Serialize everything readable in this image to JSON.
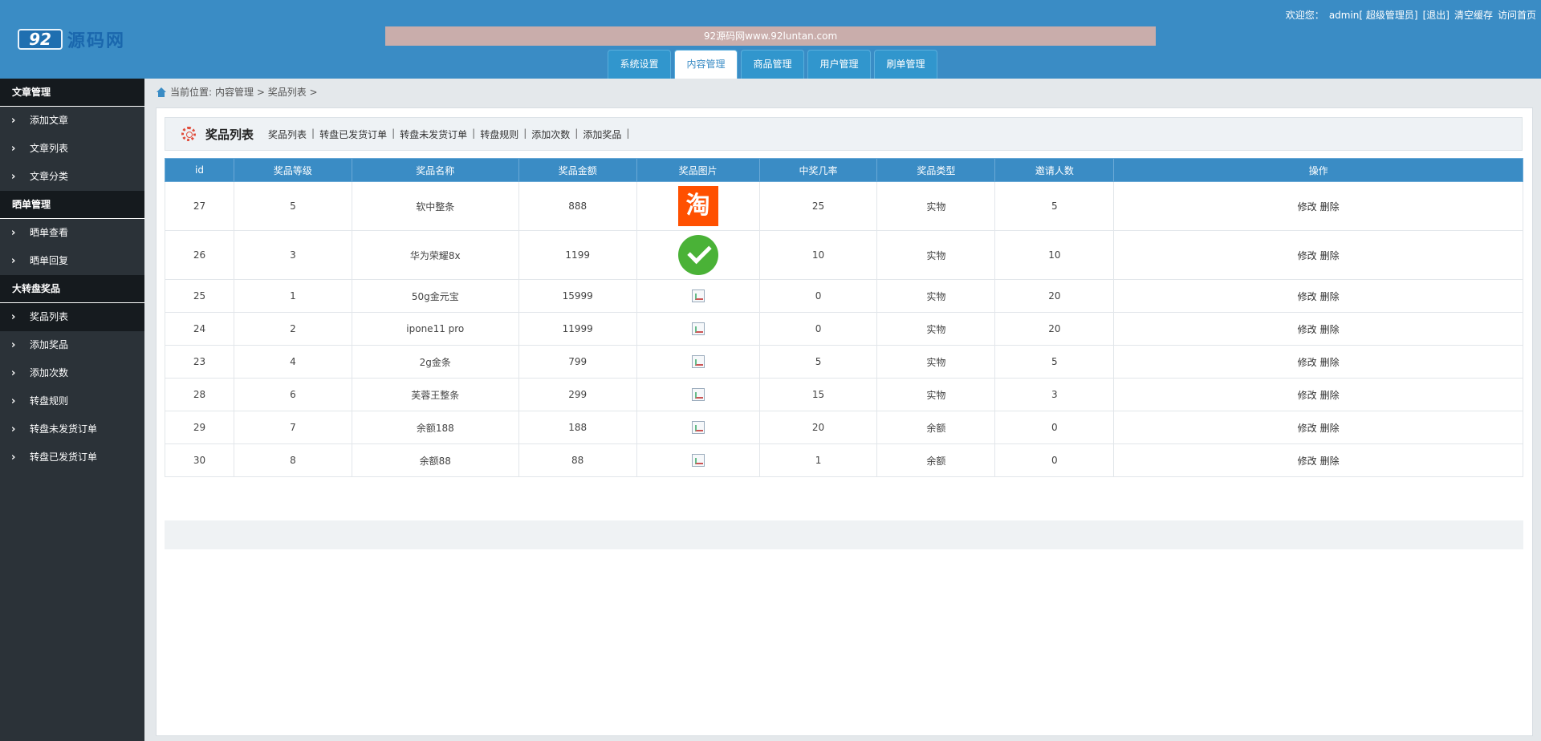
{
  "header": {
    "logo_badge": "92",
    "logo_text": "源码网",
    "banner": "92源码网www.92luntan.com",
    "tabs": [
      {
        "label": "系统设置",
        "active": false
      },
      {
        "label": "内容管理",
        "active": true
      },
      {
        "label": "商品管理",
        "active": false
      },
      {
        "label": "用户管理",
        "active": false
      },
      {
        "label": "刷单管理",
        "active": false
      }
    ],
    "user": {
      "welcome": "欢迎您：",
      "name": "admin[ 超级管理员]",
      "logout": "[退出]",
      "clear_cache": "清空缓存",
      "visit_home": "访问首页"
    }
  },
  "sidebar": {
    "groups": [
      {
        "title": "文章管理",
        "items": [
          "添加文章",
          "文章列表",
          "文章分类"
        ]
      },
      {
        "title": "晒单管理",
        "items": [
          "晒单查看",
          "晒单回复"
        ]
      },
      {
        "title": "大转盘奖品",
        "items": [
          "奖品列表",
          "添加奖品",
          "添加次数",
          "转盘规则",
          "转盘未发货订单",
          "转盘已发货订单"
        ]
      }
    ],
    "active_item": "奖品列表"
  },
  "breadcrumb": {
    "prefix": "当前位置:",
    "path": "内容管理 > 奖品列表 >"
  },
  "main": {
    "title": "奖品列表",
    "links": [
      "奖品列表",
      "转盘已发货订单",
      "转盘未发货订单",
      "转盘规则",
      "添加次数",
      "添加奖品"
    ],
    "table": {
      "headers": [
        "id",
        "奖品等级",
        "奖品名称",
        "奖品金额",
        "奖品图片",
        "中奖几率",
        "奖品类型",
        "邀请人数",
        "操作"
      ],
      "rows": [
        {
          "id": "27",
          "level": "5",
          "name": "软中整条",
          "amount": "888",
          "image": "taobao-icon",
          "rate": "25",
          "type": "实物",
          "invites": "5"
        },
        {
          "id": "26",
          "level": "3",
          "name": "华为荣耀8x",
          "amount": "1199",
          "image": "wechat-icon",
          "rate": "10",
          "type": "实物",
          "invites": "10"
        },
        {
          "id": "25",
          "level": "1",
          "name": "50g金元宝",
          "amount": "15999",
          "image": "broken-image-icon",
          "rate": "0",
          "type": "实物",
          "invites": "20"
        },
        {
          "id": "24",
          "level": "2",
          "name": "ipone11 pro",
          "amount": "11999",
          "image": "broken-image-icon",
          "rate": "0",
          "type": "实物",
          "invites": "20"
        },
        {
          "id": "23",
          "level": "4",
          "name": "2g金条",
          "amount": "799",
          "image": "broken-image-icon",
          "rate": "5",
          "type": "实物",
          "invites": "5"
        },
        {
          "id": "28",
          "level": "6",
          "name": "芙蓉王整条",
          "amount": "299",
          "image": "broken-image-icon",
          "rate": "15",
          "type": "实物",
          "invites": "3"
        },
        {
          "id": "29",
          "level": "7",
          "name": "余额188",
          "amount": "188",
          "image": "broken-image-icon",
          "rate": "20",
          "type": "余额",
          "invites": "0"
        },
        {
          "id": "30",
          "level": "8",
          "name": "余额88",
          "amount": "88",
          "image": "broken-image-icon",
          "rate": "1",
          "type": "余额",
          "invites": "0"
        }
      ],
      "edit_label": "修改",
      "delete_label": "删除",
      "taobao_glyph": "淘"
    }
  }
}
